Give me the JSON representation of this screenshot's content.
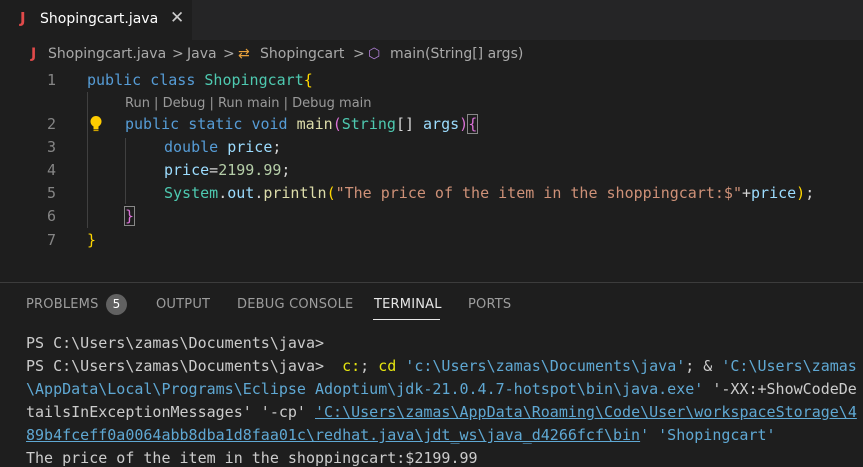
{
  "tab": {
    "icon": "J",
    "title": "Shopingcart.java",
    "close": "✕"
  },
  "breadcrumbs": {
    "file_icon": "J",
    "file": "Shopingcart.java",
    "sep": ">",
    "folder": "Java",
    "class_icon": "⇄",
    "class": "Shopingcart",
    "method_icon": "⬡",
    "method": "main(String[] args)"
  },
  "editor": {
    "line_numbers": [
      "1",
      "2",
      "3",
      "4",
      "5",
      "6",
      "7"
    ],
    "codelens": "Run | Debug | Run main | Debug main",
    "line1": {
      "kw1": "public",
      "kw2": "class",
      "name": "Shopingcart",
      "brace": "{"
    },
    "line2": {
      "kw1": "public",
      "kw2": "static",
      "kw3": "void",
      "fn": "main",
      "paren_open": "(",
      "type": "String",
      "arr": "[] ",
      "param": "args",
      "paren_close": ")",
      "brace": "{"
    },
    "line3": {
      "type": "double",
      "var": "price",
      "end": ";"
    },
    "line4": {
      "var": "price",
      "eq": "=",
      "num": "2199.99",
      "end": ";"
    },
    "line5": {
      "obj": "System",
      "dot1": ".",
      "field": "out",
      "dot2": ".",
      "fn": "println",
      "paren_open": "(",
      "str": "\"The price of the item in the shoppingcart:$\"",
      "plus": "+",
      "var": "price",
      "paren_close": ")",
      "end": ";"
    },
    "line6": {
      "brace": "}"
    },
    "line7": {
      "brace": "}"
    }
  },
  "panel": {
    "tabs": [
      "PROBLEMS",
      "OUTPUT",
      "DEBUG CONSOLE",
      "TERMINAL",
      "PORTS"
    ],
    "problems_count": "5",
    "active_tab": "TERMINAL"
  },
  "terminal": {
    "line1": "PS C:\\Users\\zamas\\Documents\\java>",
    "line2_prompt": "PS C:\\Users\\zamas\\Documents\\java>  ",
    "line2_cmd1": "c:",
    "line2_semi": "; ",
    "line2_cd": "cd",
    "line2_path": " 'c:\\Users\\zamas\\Documents\\java'",
    "line2_amp": "; & ",
    "line2_java_a": "'C:\\Users\\zamas",
    "line3_java_b": "\\AppData\\Local\\Programs\\Eclipse Adoptium\\jdk-21.0.4.7-hotspot\\bin\\java.exe'",
    "line3_flag_a": " '-XX:+ShowCodeDe",
    "line4_flag_b": "tailsInExceptionMessages'",
    "line4_cp": " '-cp' ",
    "line4_link_a": "'C:\\Users\\zamas\\AppData\\Roaming\\Code\\User\\workspaceStorage\\4",
    "line5_link_b": "89b4fceff0a0064abb8dba1d8faa01c\\redhat.java\\jdt_ws\\java_d4266fcf\\bin",
    "line5_q": "'",
    "line5_class": " 'Shopingcart'",
    "line6": "The price of the item in the shoppingcart:$2199.99"
  },
  "colors": {
    "accent_red": "#e04a4a",
    "keyword": "#569cd6",
    "type": "#4ec9b0",
    "string": "#ce9178",
    "lightbulb": "#ffcc00"
  }
}
